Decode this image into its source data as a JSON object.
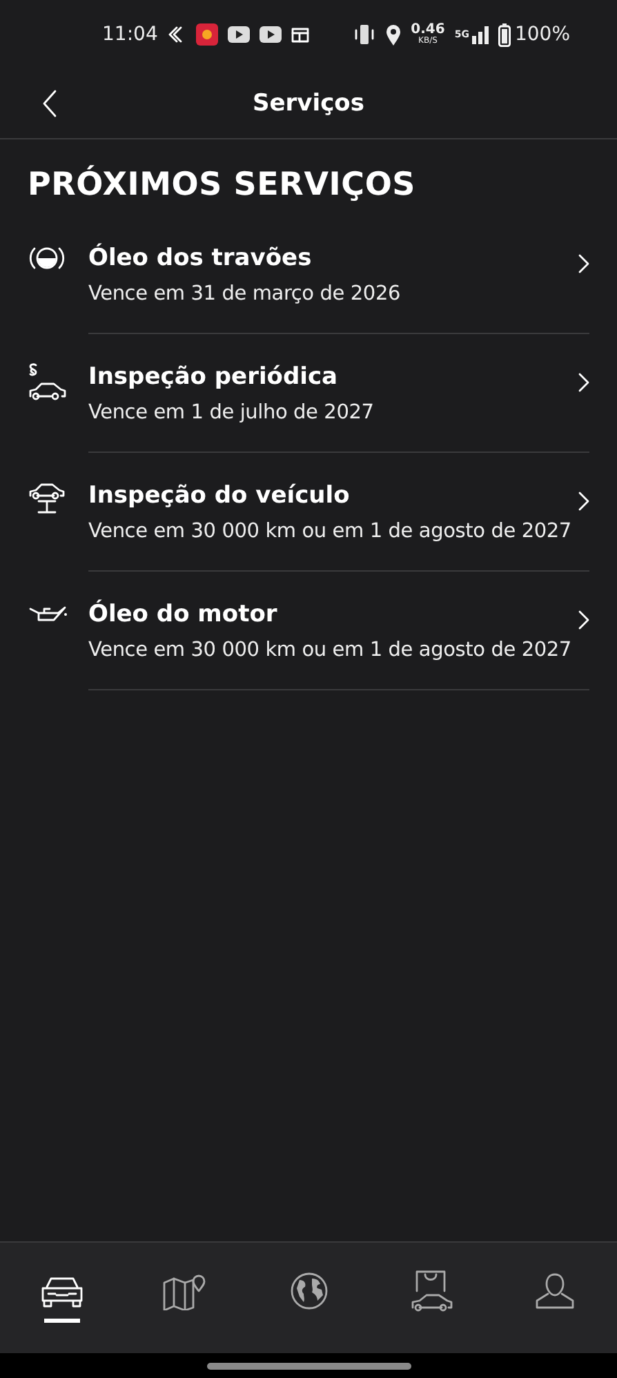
{
  "status_bar": {
    "time": "11:04",
    "speed": "0.46",
    "speed_unit": "KB/S",
    "network": "5G",
    "battery": "100%"
  },
  "header": {
    "title": "Serviços"
  },
  "section_title": "PRÓXIMOS SERVIÇOS",
  "services": [
    {
      "kind": "brake-fluid",
      "title": "Óleo dos travões",
      "due": "Vence em 31 de março de 2026"
    },
    {
      "kind": "inspection",
      "title": "Inspeção periódica",
      "due": "Vence em 1 de julho de 2027"
    },
    {
      "kind": "lift",
      "title": "Inspeção do veículo",
      "due": "Vence em 30 000 km ou em 1 de agosto de 2027"
    },
    {
      "kind": "oil",
      "title": "Óleo do motor",
      "due": "Vence em 30 000 km ou em 1 de agosto de 2027"
    }
  ],
  "nav": [
    {
      "kind": "car",
      "selected": true
    },
    {
      "kind": "map",
      "selected": false
    },
    {
      "kind": "globe",
      "selected": false
    },
    {
      "kind": "shop",
      "selected": false
    },
    {
      "kind": "profile",
      "selected": false
    }
  ]
}
